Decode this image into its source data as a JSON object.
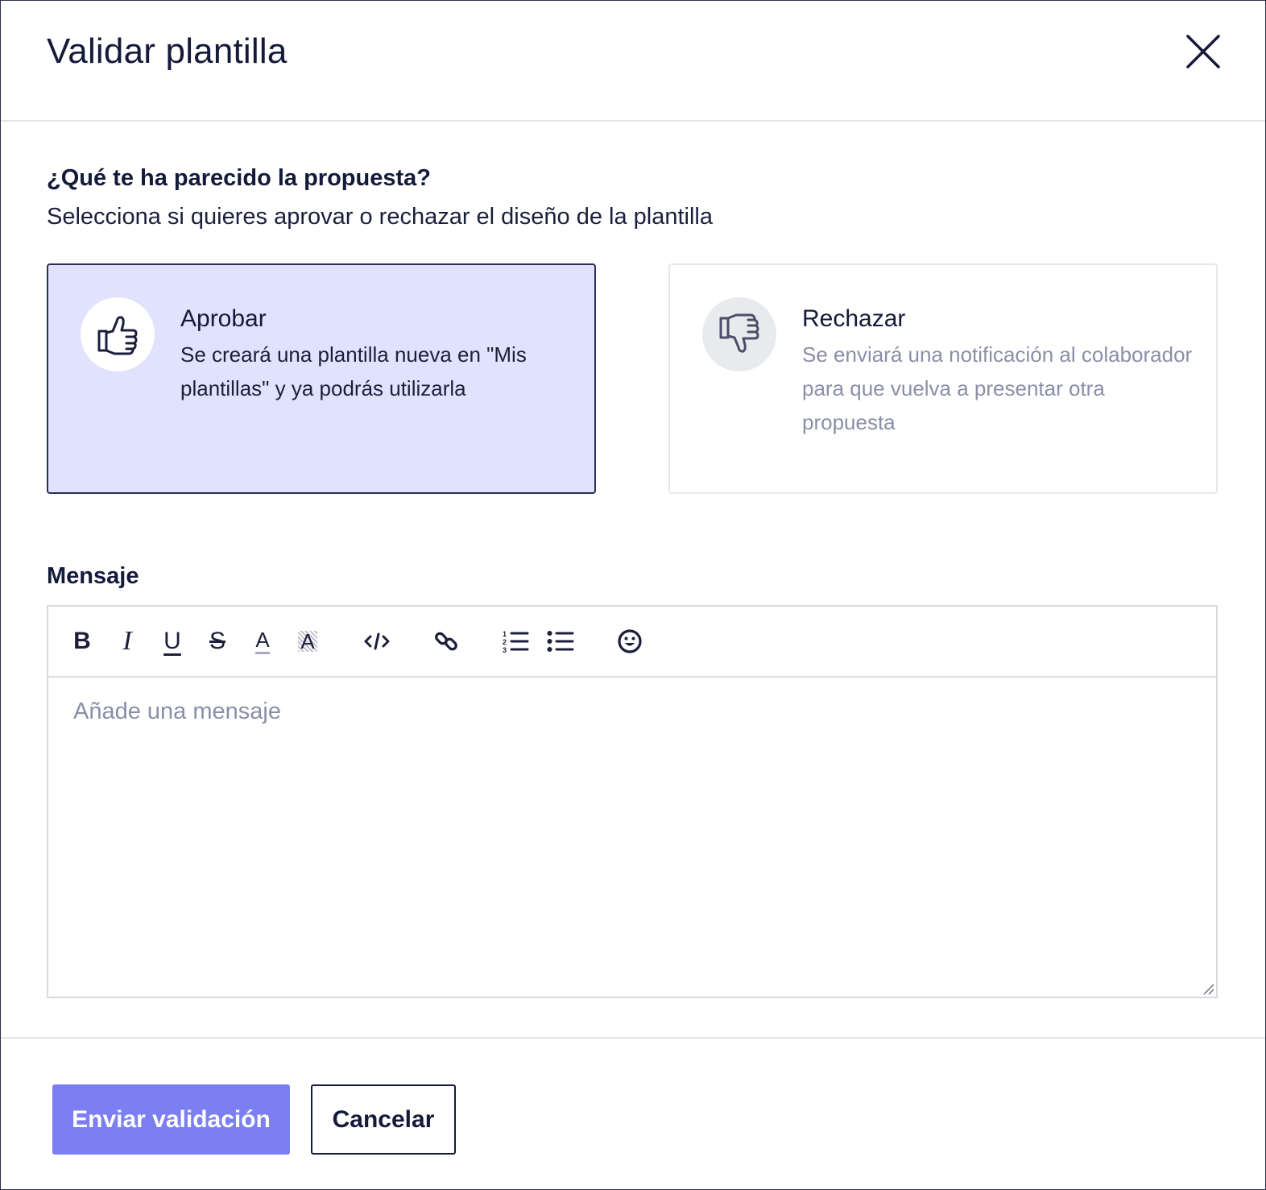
{
  "modal": {
    "title": "Validar plantilla",
    "close_icon": "close-icon"
  },
  "prompt": {
    "question": "¿Qué te ha parecido la propuesta?",
    "subtext": "Selecciona si quieres aprovar o rechazar el diseño de la plantilla"
  },
  "options": {
    "approve": {
      "title": "Aprobar",
      "description": "Se creará una plantilla nueva en \"Mis plantillas\" y ya podrás utilizarla",
      "icon": "thumbs-up-icon",
      "selected": true
    },
    "reject": {
      "title": "Rechazar",
      "description": "Se enviará una notificación al colaborador para que vuelva a presentar otra propuesta",
      "icon": "thumbs-down-icon",
      "selected": false
    }
  },
  "message": {
    "label": "Mensaje",
    "placeholder": "Añade una mensaje",
    "value": "",
    "toolbar": {
      "bold": "B",
      "italic": "I",
      "underline": "U",
      "strikethrough": "S",
      "text_color": "A",
      "highlight": "A",
      "icons": [
        "bold-icon",
        "italic-icon",
        "underline-icon",
        "strikethrough-icon",
        "text-color-icon",
        "highlight-icon",
        "code-icon",
        "link-icon",
        "ordered-list-icon",
        "bullet-list-icon",
        "emoji-icon"
      ]
    }
  },
  "actions": {
    "submit_label": "Enviar validación",
    "cancel_label": "Cancelar"
  },
  "colors": {
    "accent": "#7b7ff2",
    "selected_bg": "#e1e2fd",
    "text_dark": "#141a3a",
    "text_muted": "#8a8fa6"
  }
}
